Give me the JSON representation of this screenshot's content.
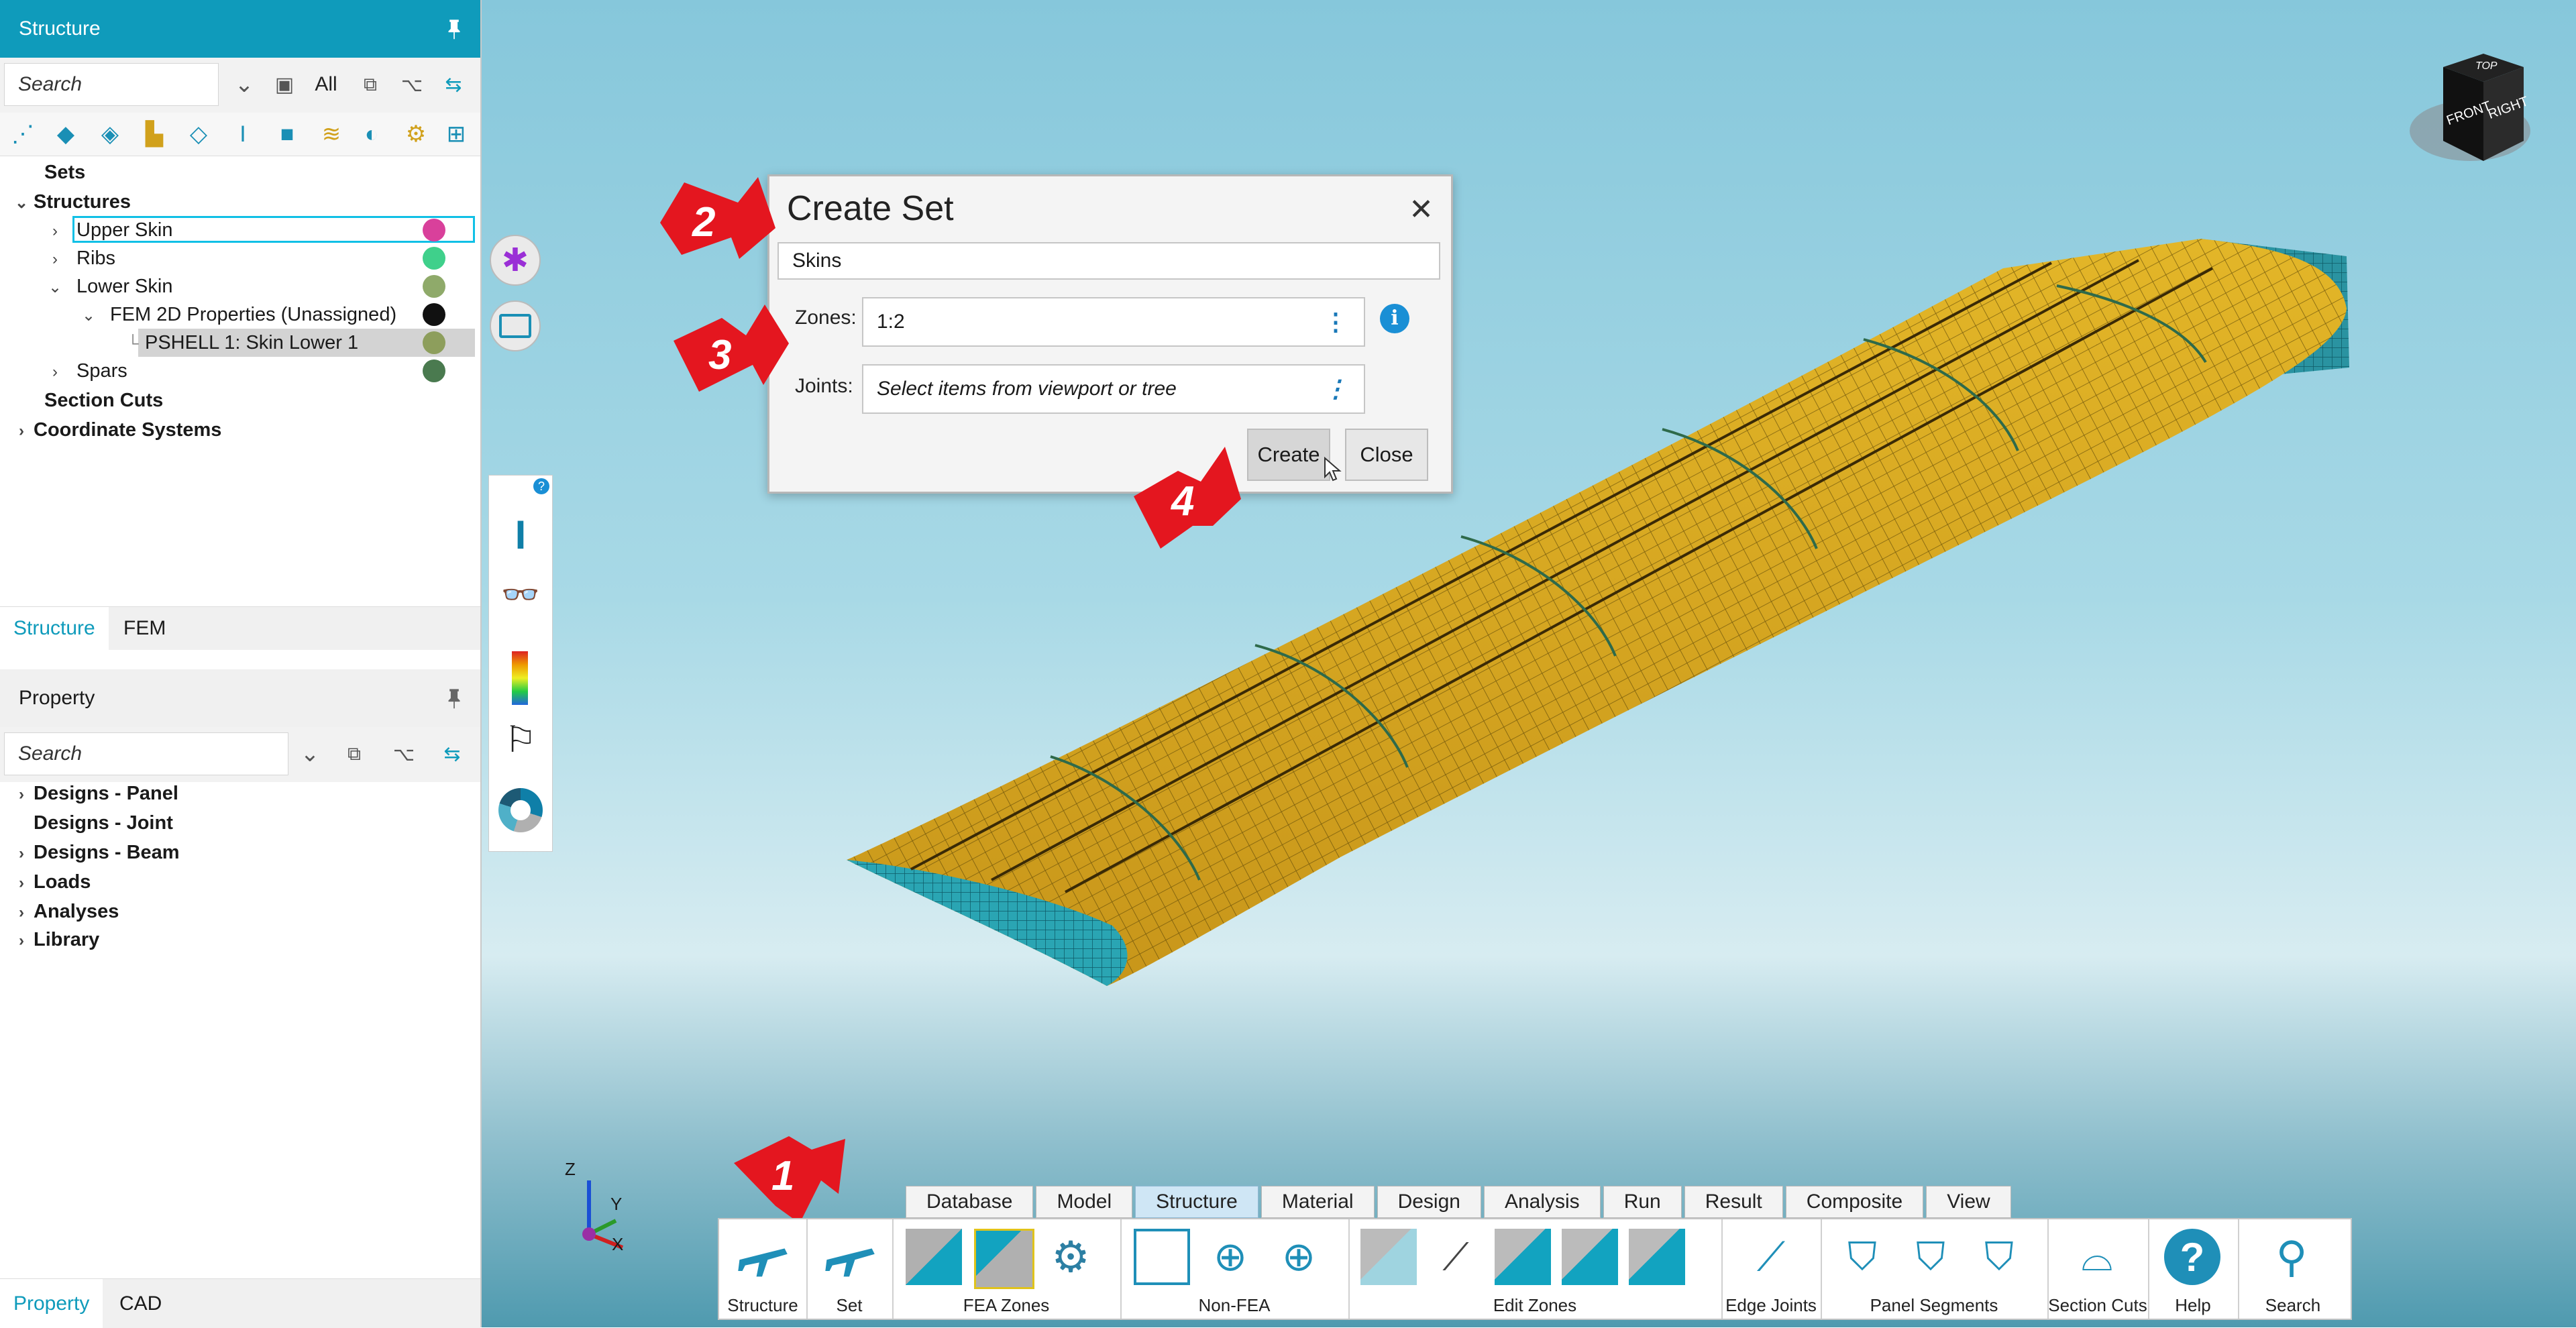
{
  "structure_panel": {
    "title": "Structure",
    "search_placeholder": "Search",
    "filter_label": "All",
    "tree": [
      {
        "label": "Sets",
        "indent": 0,
        "arrow": "",
        "bold": true
      },
      {
        "label": "Structures",
        "indent": 0,
        "arrow": "v",
        "bold": true
      },
      {
        "label": "Upper Skin",
        "indent": 1,
        "arrow": ">",
        "bold": false,
        "color": "#d9409b",
        "selected": true
      },
      {
        "label": "Ribs",
        "indent": 1,
        "arrow": ">",
        "bold": false,
        "color": "#3fd08b"
      },
      {
        "label": "Lower Skin",
        "indent": 1,
        "arrow": "v",
        "bold": false,
        "color": "#8faa6a"
      },
      {
        "label": "FEM 2D Properties (Unassigned)",
        "indent": 2,
        "arrow": "v",
        "bold": false,
        "color": "#111111"
      },
      {
        "label": "PSHELL 1: Skin Lower 1",
        "indent": 3,
        "arrow": "",
        "bold": false,
        "color": "#8d9e5c",
        "highlight": true
      },
      {
        "label": "Spars",
        "indent": 1,
        "arrow": ">",
        "bold": false,
        "color": "#4a7a4f"
      },
      {
        "label": "Section Cuts",
        "indent": 0,
        "arrow": "",
        "bold": true
      },
      {
        "label": "Coordinate Systems",
        "indent": 0,
        "arrow": ">",
        "bold": true
      }
    ],
    "tabs": [
      "Structure",
      "FEM"
    ]
  },
  "property_panel": {
    "title": "Property",
    "search_placeholder": "Search",
    "tree": [
      {
        "label": "Designs - Panel",
        "arrow": ">"
      },
      {
        "label": "Designs - Joint",
        "arrow": ""
      },
      {
        "label": "Designs - Beam",
        "arrow": ">"
      },
      {
        "label": "Loads",
        "arrow": ">"
      },
      {
        "label": "Analyses",
        "arrow": ">"
      },
      {
        "label": "Library",
        "arrow": ">"
      }
    ],
    "tabs": [
      "Property",
      "CAD"
    ]
  },
  "dialog": {
    "title": "Create Set",
    "name_value": "Skins",
    "zones_label": "Zones:",
    "zones_value": "1:2",
    "joints_label": "Joints:",
    "joints_placeholder": "Select items from viewport or tree",
    "create_label": "Create",
    "close_label": "Close"
  },
  "callouts": [
    "1",
    "2",
    "3",
    "4"
  ],
  "view_cube": {
    "front": "FRONT",
    "right": "RIGHT",
    "top": "TOP"
  },
  "axis": {
    "z": "Z",
    "y": "Y",
    "x": "X"
  },
  "ribbon": {
    "tabs": [
      "Database",
      "Model",
      "Structure",
      "Material",
      "Design",
      "Analysis",
      "Run",
      "Result",
      "Composite",
      "View"
    ],
    "active_tab": "Structure",
    "groups": {
      "structure": "Structure",
      "set": "Set",
      "fea_zones": "FEA Zones",
      "non_fea": "Non-FEA",
      "edit_zones": "Edit Zones",
      "edge_joints": "Edge Joints",
      "panel_segments": "Panel Segments",
      "section_cuts": "Section Cuts",
      "help": "Help",
      "search": "Search"
    }
  },
  "colors": {
    "accent": "#0f9bbb",
    "callout": "#e4161f",
    "wing_skin": "#d4a51c",
    "wing_mesh": "#2e9aa6"
  }
}
